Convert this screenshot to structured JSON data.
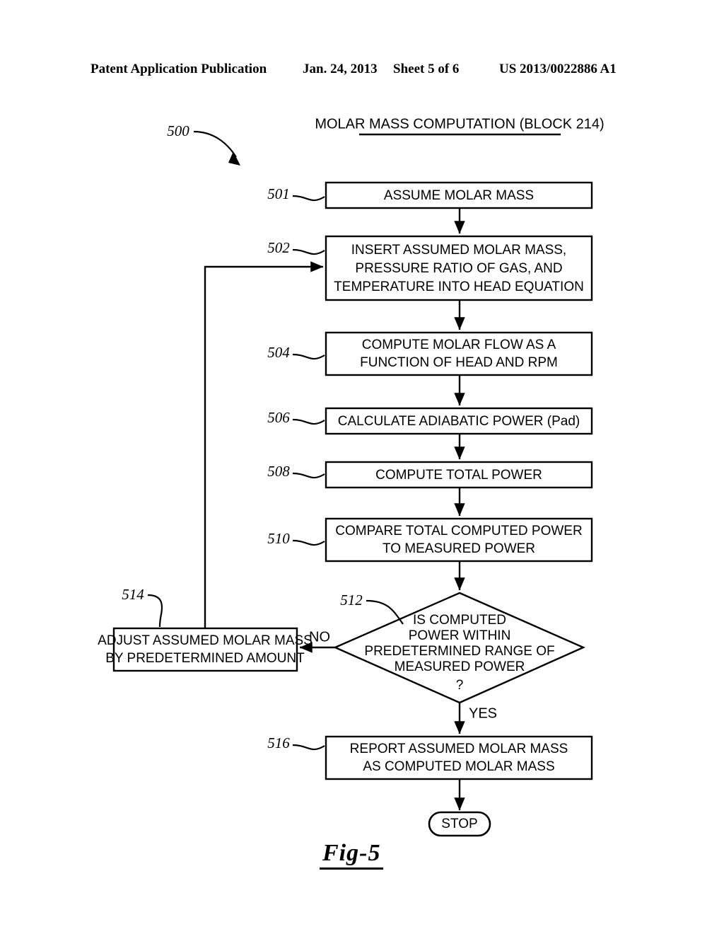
{
  "header": {
    "publication": "Patent Application Publication",
    "date": "Jan. 24, 2013",
    "sheet": "Sheet 5 of 6",
    "number": "US 2013/0022886 A1"
  },
  "figure": {
    "caption": "Fig-5",
    "diagram_ref": "500",
    "title": "MOLAR MASS COMPUTATION (BLOCK 214)"
  },
  "nodes": {
    "n501": {
      "ref": "501",
      "type": "process",
      "lines": [
        "ASSUME MOLAR MASS"
      ]
    },
    "n502": {
      "ref": "502",
      "type": "process",
      "lines": [
        "INSERT ASSUMED MOLAR MASS,",
        "PRESSURE RATIO OF GAS, AND",
        "TEMPERATURE INTO HEAD EQUATION"
      ]
    },
    "n504": {
      "ref": "504",
      "type": "process",
      "lines": [
        "COMPUTE MOLAR FLOW AS A",
        "FUNCTION OF HEAD AND RPM"
      ]
    },
    "n506": {
      "ref": "506",
      "type": "process",
      "lines": [
        "CALCULATE ADIABATIC POWER (Pad)"
      ]
    },
    "n508": {
      "ref": "508",
      "type": "process",
      "lines": [
        "COMPUTE TOTAL POWER"
      ]
    },
    "n510": {
      "ref": "510",
      "type": "process",
      "lines": [
        "COMPARE TOTAL COMPUTED POWER",
        "TO MEASURED POWER"
      ]
    },
    "n512": {
      "ref": "512",
      "type": "decision",
      "lines": [
        "IS COMPUTED",
        "POWER WITHIN",
        "PREDETERMINED RANGE OF",
        "MEASURED POWER",
        "?"
      ]
    },
    "n514": {
      "ref": "514",
      "type": "process",
      "lines": [
        "ADJUST ASSUMED MOLAR MASS",
        "BY PREDETERMINED AMOUNT"
      ]
    },
    "n516": {
      "ref": "516",
      "type": "process",
      "lines": [
        "REPORT ASSUMED MOLAR MASS",
        "AS COMPUTED MOLAR MASS"
      ]
    },
    "nstop": {
      "ref": "",
      "type": "terminator",
      "lines": [
        "STOP"
      ]
    }
  },
  "branches": {
    "no_label": "NO",
    "yes_label": "YES"
  },
  "colors": {
    "ink": "#000000",
    "paper": "#ffffff"
  }
}
